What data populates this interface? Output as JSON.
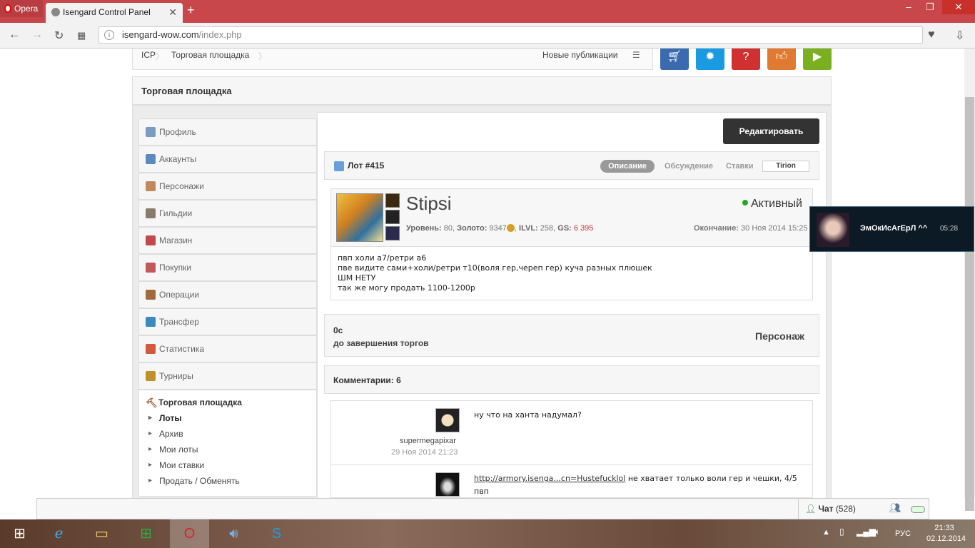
{
  "browser": {
    "menu_label": "Opera",
    "tab_title": "Isengard Control Panel",
    "url_host": "isengard-wow.com",
    "url_path": "/index.php"
  },
  "breadcrumb": {
    "root": "ICP",
    "current": "Торговая площадка",
    "new_posts": "Новые публикации"
  },
  "section_title": "Торговая площадка",
  "sidebar": {
    "items": [
      {
        "label": "Профиль",
        "color": "#7a9cc0"
      },
      {
        "label": "Аккаунты",
        "color": "#5a8ac0"
      },
      {
        "label": "Персонажи",
        "color": "#c08a5a"
      },
      {
        "label": "Гильдии",
        "color": "#8a7a6a"
      },
      {
        "label": "Магазин",
        "color": "#c04a4a"
      },
      {
        "label": "Покупки",
        "color": "#c05a5a"
      },
      {
        "label": "Операции",
        "color": "#a06a3a"
      },
      {
        "label": "Трансфер",
        "color": "#3a8ac0"
      },
      {
        "label": "Статистика",
        "color": "#d05a3a"
      },
      {
        "label": "Турниры",
        "color": "#c0902a"
      }
    ],
    "market_title": "Торговая площадка",
    "sub_items": [
      "Лоты",
      "Архив",
      "Мои лоты",
      "Мои ставки",
      "Продать / Обменять"
    ]
  },
  "main": {
    "edit_button": "Редактировать",
    "lot_title": "Лот #415",
    "tabs": [
      "Описание",
      "Обсуждение",
      "Ставки"
    ],
    "realm": "Tirion",
    "char_name": "Stipsi",
    "status": "Активный",
    "stats": {
      "level_label": "Уровень:",
      "level": "80",
      "gold_label": "Золото:",
      "gold": "9347",
      "ilvl_label": "ILVL:",
      "ilvl": "258",
      "gs_label": "GS:",
      "gs": "6 395"
    },
    "end_label": "Окончание:",
    "end_date": "30 Ноя 2014 15:25",
    "description": [
      "пвп холи а7/ретри а6",
      "пве видите сами+холи/ретри т10(воля гер,череп гер) куча разных плюшек",
      "ШМ НЕТУ",
      "так же могу продать 1100-1200р"
    ],
    "timer_value": "0с",
    "timer_label": "до завершения торгов",
    "character_label": "Персонаж",
    "comments_title": "Комментарии: 6",
    "comments": [
      {
        "user": "supermegapixar",
        "date": "29 Ноя 2014 21:23",
        "text": "ну что на ханта надумал?"
      },
      {
        "link": "http://armory.isenga...cn=Hustefucklol",
        "text": "не хватает только воли гер и чешки, 4/5 пвп"
      }
    ]
  },
  "notification": {
    "name": "ЭмОкИсАгЕрЛ ^^",
    "time": "05:28"
  },
  "chat": {
    "label": "Чат",
    "count": "(528)"
  },
  "taskbar": {
    "lang": "РУС",
    "time": "21:33",
    "date": "02.12.2014"
  }
}
